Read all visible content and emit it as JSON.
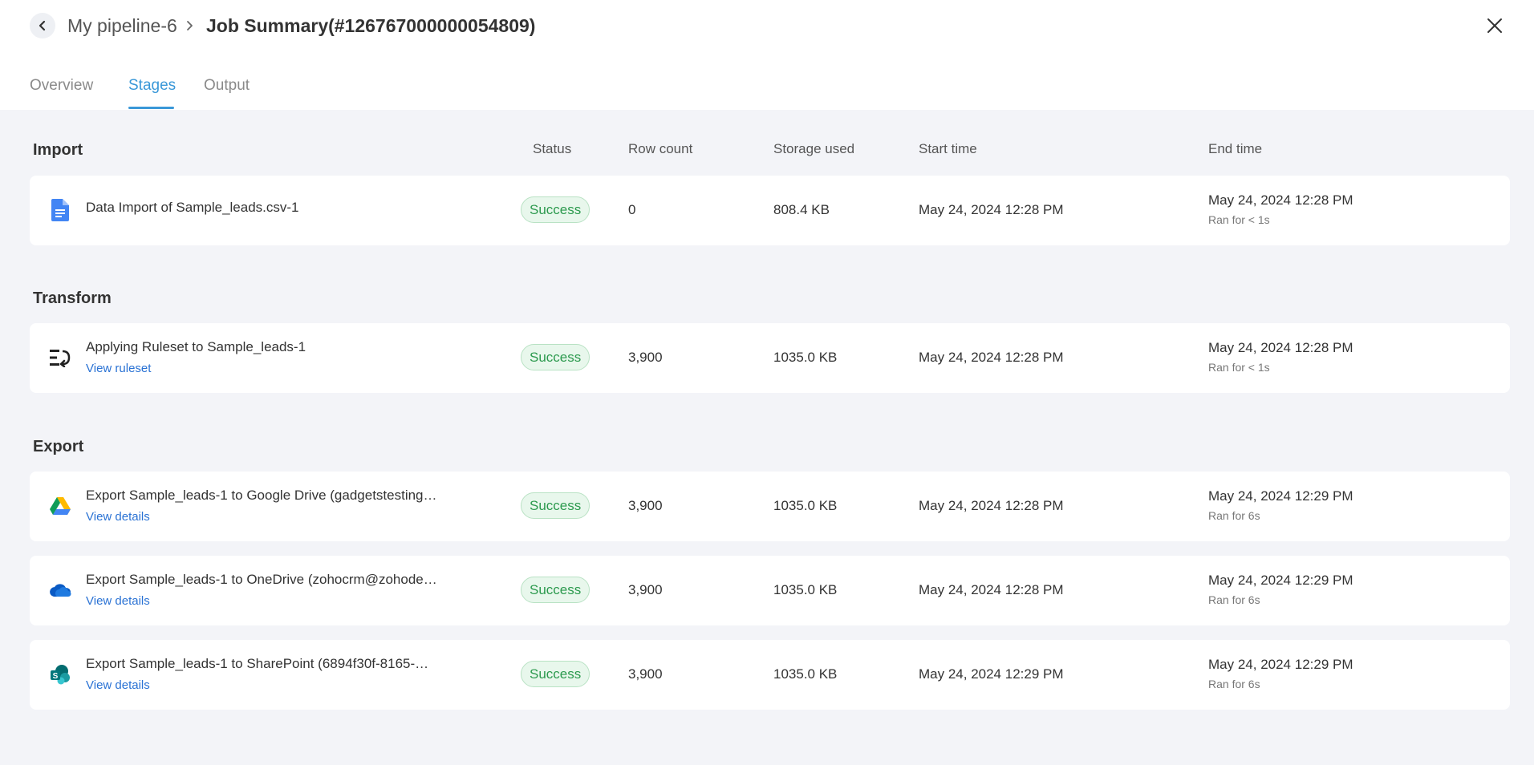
{
  "header": {
    "pipeline_name": "My pipeline-6",
    "job_title": "Job Summary(#126767000000054809)"
  },
  "tabs": [
    {
      "label": "Overview",
      "active": false
    },
    {
      "label": "Stages",
      "active": true
    },
    {
      "label": "Output",
      "active": false
    }
  ],
  "columns": {
    "status": "Status",
    "row_count": "Row count",
    "storage_used": "Storage used",
    "start_time": "Start time",
    "end_time": "End time"
  },
  "sections": {
    "import": "Import",
    "transform": "Transform",
    "export": "Export"
  },
  "stages": [
    {
      "icon": "document-icon",
      "name": "Data Import of Sample_leads.csv-1",
      "link": "",
      "status": "Success",
      "row_count": "0",
      "storage": "808.4 KB",
      "start": "May 24, 2024 12:28 PM",
      "end": "May 24, 2024 12:28 PM",
      "ran": "Ran for < 1s"
    },
    {
      "icon": "ruleset-icon",
      "name": "Applying Ruleset to Sample_leads-1",
      "link": "View ruleset",
      "status": "Success",
      "row_count": "3,900",
      "storage": "1035.0 KB",
      "start": "May 24, 2024 12:28 PM",
      "end": "May 24, 2024 12:28 PM",
      "ran": "Ran for < 1s"
    },
    {
      "icon": "google-drive-icon",
      "name": "Export Sample_leads-1 to Google Drive (gadgetstesting…",
      "link": "View details",
      "status": "Success",
      "row_count": "3,900",
      "storage": "1035.0 KB",
      "start": "May 24, 2024 12:28 PM",
      "end": "May 24, 2024 12:29 PM",
      "ran": "Ran for 6s"
    },
    {
      "icon": "onedrive-icon",
      "name": "Export Sample_leads-1 to OneDrive (zohocrm@zohode…",
      "link": "View details",
      "status": "Success",
      "row_count": "3,900",
      "storage": "1035.0 KB",
      "start": "May 24, 2024 12:28 PM",
      "end": "May 24, 2024 12:29 PM",
      "ran": "Ran for 6s"
    },
    {
      "icon": "sharepoint-icon",
      "name": "Export Sample_leads-1 to SharePoint (6894f30f-8165-…",
      "link": "View details",
      "status": "Success",
      "row_count": "3,900",
      "storage": "1035.0 KB",
      "start": "May 24, 2024 12:29 PM",
      "end": "May 24, 2024 12:29 PM",
      "ran": "Ran for 6s"
    }
  ],
  "colors": {
    "accent": "#3a98d8",
    "link": "#2a72d4",
    "success_text": "#2c9a4e",
    "success_bg": "#e8f7ec",
    "page_bg": "#f3f4f8"
  }
}
